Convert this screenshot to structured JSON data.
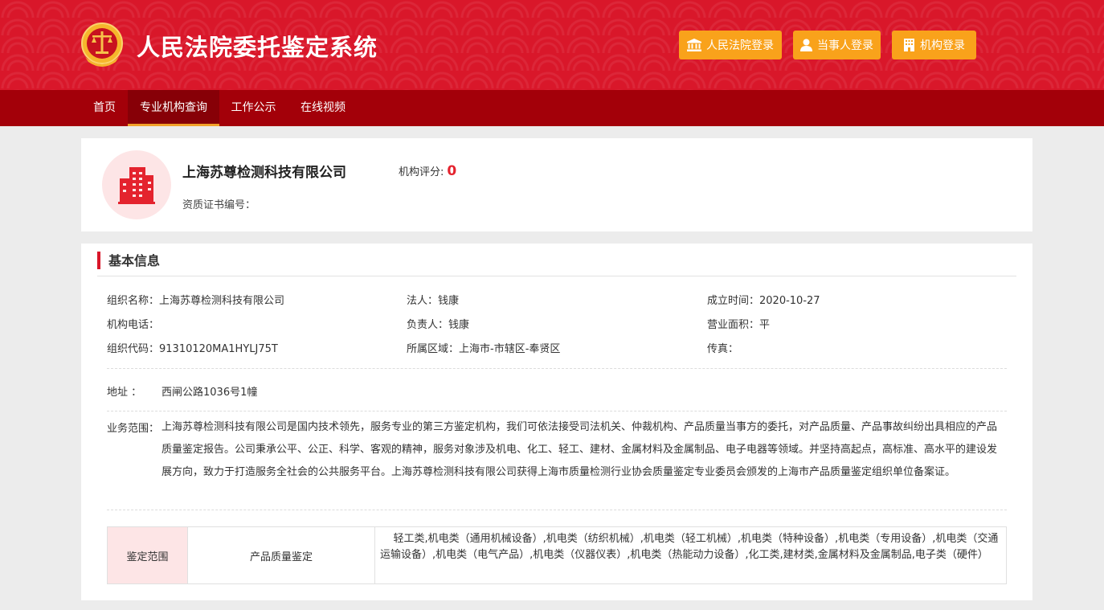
{
  "header": {
    "site_title": "人民法院委托鉴定系统",
    "buttons": {
      "court_login": "人民法院登录",
      "party_login": "当事人登录",
      "org_login": "机构登录"
    },
    "colors": {
      "primary": "#d9172a",
      "nav": "#a30009",
      "button": "#f9a21b"
    }
  },
  "nav": {
    "items": [
      {
        "label": "首页"
      },
      {
        "label": "专业机构查询",
        "active": true
      },
      {
        "label": "工作公示"
      },
      {
        "label": "在线视频"
      }
    ]
  },
  "org": {
    "name": "上海苏尊检测科技有限公司",
    "score_label": "机构评分:",
    "score_value": "0",
    "cert_label": "资质证书编号："
  },
  "basic_info": {
    "title": "基本信息",
    "fields": {
      "org_name": "组织名称：上海苏尊检测科技有限公司",
      "legal_person": "法人：钱康",
      "founded": "成立时间：2020-10-27",
      "phone": "机构电话：",
      "manager": "负责人：钱康",
      "area": "营业面积：平",
      "org_code": "组织代码：91310120MA1HYLJ75T",
      "region": "所属区域：上海市-市辖区-奉贤区",
      "fax": "传真："
    },
    "address_label": "地址 ：",
    "address_value": "西闸公路1036号1幢",
    "scope_label": "业务范围：",
    "scope_text": "上海苏尊检测科技有限公司是国内技术领先，服务专业的第三方鉴定机构，我们可依法接受司法机关、仲裁机构、产品质量当事方的委托，对产品质量、产品事故纠纷出具相应的产品质量鉴定报告。公司秉承公平、公正、科学、客观的精神，服务对象涉及机电、化工、轻工、建材、金属材料及金属制品、电子电器等领域。并坚持高起点，高标准、高水平的建设发展方向，致力于打造服务全社会的公共服务平台。上海苏尊检测科技有限公司获得上海市质量检测行业协会质量鉴定专业委员会颁发的上海市产品质量鉴定组织单位备案证。"
  },
  "appraisal": {
    "head": "鉴定范围",
    "type": "产品质量鉴定",
    "detail": "轻工类,机电类（通用机械设备）,机电类（纺织机械）,机电类（轻工机械）,机电类（特种设备）,机电类（专用设备）,机电类（交通运输设备）,机电类（电气产品）,机电类（仪器仪表）,机电类（热能动力设备）,化工类,建材类,金属材料及金属制品,电子类（硬件）"
  }
}
